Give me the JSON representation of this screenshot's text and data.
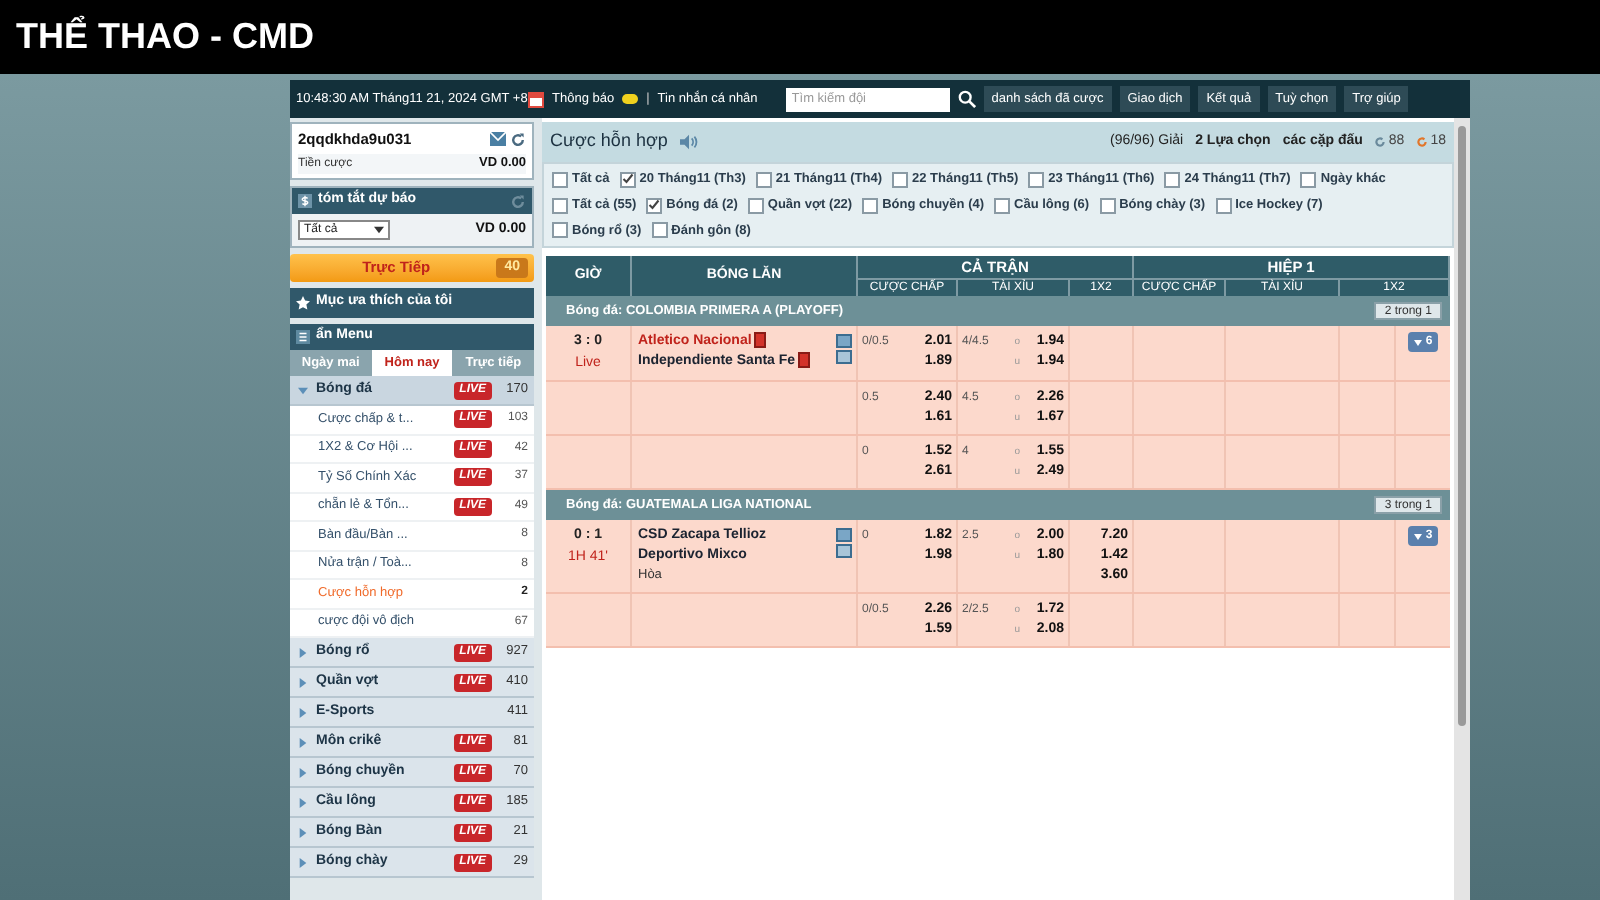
{
  "header": {
    "title": "THỂ THAO - CMD"
  },
  "topbar": {
    "datetime": "10:48:30 AM Tháng11 21, 2024 GMT +8",
    "notice": "Thông báo",
    "separator": "|",
    "messages": "Tin nhắn cá nhân",
    "search": {
      "placeholder": "Tìm kiếm đội"
    },
    "buttons": [
      "danh sách đã cược",
      "Giao dịch",
      "Kết quả",
      "Tuỳ chọn",
      "Trợ giúp"
    ]
  },
  "sidebar": {
    "account": {
      "username": "2qqdkhda9u031",
      "balance_label": "Tiền cược",
      "balance": "VD 0.00"
    },
    "summary": {
      "title": "tóm tắt dự báo",
      "select": "Tất cả",
      "amount": "VD 0.00"
    },
    "live": {
      "label": "Trực Tiếp",
      "count": "40"
    },
    "favorites": "Mục ưa thích của tôi",
    "menu": "ẩn Menu",
    "tabs": [
      {
        "label": "Ngày mai",
        "selected": false
      },
      {
        "label": "Hôm nay",
        "selected": true
      },
      {
        "label": "Trực tiếp",
        "selected": false
      }
    ],
    "sports": [
      {
        "name": "Bóng đá",
        "badge": "LIVE",
        "count": "170",
        "expanded": true,
        "children": [
          {
            "name": "Cược chấp & t...",
            "badge": "LIVE",
            "count": "103",
            "selected": false
          },
          {
            "name": "1X2 & Cơ Hội ...",
            "badge": "LIVE",
            "count": "42",
            "selected": false
          },
          {
            "name": "Tỷ Số Chính Xác",
            "badge": "LIVE",
            "count": "37",
            "selected": false
          },
          {
            "name": "chẵn lẻ & Tổn...",
            "badge": "LIVE",
            "count": "49",
            "selected": false
          },
          {
            "name": "Bàn đầu/Bàn ...",
            "count": "8",
            "selected": false
          },
          {
            "name": "Nửa trận / Toà...",
            "count": "8",
            "selected": false
          },
          {
            "name": "Cược hỗn hợp",
            "count": "2",
            "selected": true
          },
          {
            "name": "cược đội vô địch",
            "count": "67",
            "selected": false
          }
        ]
      },
      {
        "name": "Bóng rổ",
        "badge": "LIVE",
        "count": "927",
        "expanded": false
      },
      {
        "name": "Quần vợt",
        "badge": "LIVE",
        "count": "410",
        "expanded": false
      },
      {
        "name": "E-Sports",
        "count": "411",
        "expanded": false
      },
      {
        "name": "Môn crikê",
        "badge": "LIVE",
        "count": "81",
        "expanded": false
      },
      {
        "name": "Bóng chuyền",
        "badge": "LIVE",
        "count": "70",
        "expanded": false
      },
      {
        "name": "Cầu lông",
        "badge": "LIVE",
        "count": "185",
        "expanded": false
      },
      {
        "name": "Bóng Bàn",
        "badge": "LIVE",
        "count": "21",
        "expanded": false
      },
      {
        "name": "Bóng chày",
        "badge": "LIVE",
        "count": "29",
        "expanded": false
      }
    ]
  },
  "main": {
    "title": "Cược hỗn hợp",
    "leagues_count": "(96/96) Giải",
    "choices": "2 Lựa chọn",
    "pairs": "các cặp đấu",
    "count_a": "88",
    "count_b": "18",
    "date_filters": [
      {
        "label": "Tất cả",
        "checked": false
      },
      {
        "label": "20 Tháng11 (Th3)",
        "checked": true
      },
      {
        "label": "21 Tháng11 (Th4)",
        "checked": false
      },
      {
        "label": "22 Tháng11 (Th5)",
        "checked": false
      },
      {
        "label": "23 Tháng11 (Th6)",
        "checked": false
      },
      {
        "label": "24 Tháng11 (Th7)",
        "checked": false
      },
      {
        "label": "Ngày khác",
        "checked": false
      }
    ],
    "sport_filters": [
      {
        "label": "Tất cả (55)",
        "checked": false
      },
      {
        "label": "Bóng đá (2)",
        "checked": true
      },
      {
        "label": "Quần vợt (22)",
        "checked": false
      },
      {
        "label": "Bóng chuyền (4)",
        "checked": false
      },
      {
        "label": "Cầu lông (6)",
        "checked": false
      },
      {
        "label": "Bóng chày (3)",
        "checked": false
      },
      {
        "label": "Ice Hockey (7)",
        "checked": false
      },
      {
        "label": "Bóng rổ (3)",
        "checked": false
      },
      {
        "label": "Đánh gôn (8)",
        "checked": false
      }
    ],
    "table": {
      "columns": [
        "GIỜ",
        "BÓNG LĂN"
      ],
      "groups": [
        "CẢ TRẬN",
        "HIỆP 1"
      ],
      "subcolumns": [
        "CƯỢC CHẤP",
        "TÀI XỈU",
        "1X2",
        "CƯỢC CHẤP",
        "TÀI XỈU",
        "1X2"
      ],
      "leagues": [
        {
          "name": "Bóng đá: COLOMBIA PRIMERA A (PLAYOFF)",
          "button": "2 trong 1",
          "match": {
            "score": "3 : 0",
            "status": "Live",
            "more": "6",
            "teams": [
              {
                "name": "Atletico Nacional",
                "favored": true,
                "red_card": true
              },
              {
                "name": "Independiente Santa Fe",
                "favored": false,
                "red_card": true
              }
            ],
            "lines": [
              {
                "hdp": "0/0.5",
                "hdp_odds": [
                  "2.01",
                  "1.89"
                ],
                "ou": "4/4.5",
                "marks": [
                  "o",
                  "u"
                ],
                "ou_odds": [
                  "1.94",
                  "1.94"
                ]
              },
              {
                "hdp": "0.5",
                "hdp_odds": [
                  "2.40",
                  "1.61"
                ],
                "ou": "4.5",
                "marks": [
                  "o",
                  "u"
                ],
                "ou_odds": [
                  "2.26",
                  "1.67"
                ]
              },
              {
                "hdp": "0",
                "hdp_odds": [
                  "1.52",
                  "2.61"
                ],
                "ou": "4",
                "marks": [
                  "o",
                  "u"
                ],
                "ou_odds": [
                  "1.55",
                  "2.49"
                ]
              }
            ]
          }
        },
        {
          "name": "Bóng đá: GUATEMALA LIGA NATIONAL",
          "button": "3 trong 1",
          "match": {
            "score": "0 : 1",
            "status": "1H 41'",
            "more": "3",
            "teams": [
              {
                "name": "CSD Zacapa Tellioz",
                "favored": false,
                "red_card": false
              },
              {
                "name": "Deportivo Mixco",
                "favored": false,
                "red_card": false
              }
            ],
            "draw": "Hòa",
            "lines": [
              {
                "hdp": "0",
                "hdp_odds": [
                  "1.82",
                  "1.98"
                ],
                "ou": "2.5",
                "marks": [
                  "o",
                  "u"
                ],
                "ou_odds": [
                  "2.00",
                  "1.80"
                ],
                "x12": [
                  "7.20",
                  "1.42",
                  "3.60"
                ]
              },
              {
                "hdp": "0/0.5",
                "hdp_odds": [
                  "2.26",
                  "1.59"
                ],
                "ou": "2/2.5",
                "marks": [
                  "o",
                  "u"
                ],
                "ou_odds": [
                  "1.72",
                  "2.08"
                ]
              }
            ]
          }
        }
      ]
    }
  }
}
